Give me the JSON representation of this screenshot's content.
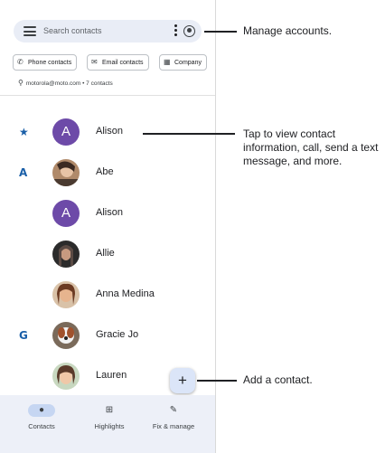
{
  "search": {
    "placeholder": "Search contacts"
  },
  "filters": [
    "Phone contacts",
    "Email contacts",
    "Company"
  ],
  "account_line": "motorola@moto.com • 7 contacts",
  "contacts": [
    {
      "index": "★",
      "initial": "A",
      "name": "Alison",
      "avatar": "letter"
    },
    {
      "index": "A",
      "initial": "",
      "name": "Abe",
      "avatar": "photo"
    },
    {
      "index": "",
      "initial": "A",
      "name": "Alison",
      "avatar": "letter"
    },
    {
      "index": "",
      "initial": "",
      "name": "Allie",
      "avatar": "photo"
    },
    {
      "index": "",
      "initial": "",
      "name": "Anna Medina",
      "avatar": "photo"
    },
    {
      "index": "G",
      "initial": "",
      "name": "Gracie Jo",
      "avatar": "photo"
    },
    {
      "index": "",
      "initial": "",
      "name": "Lauren",
      "avatar": "photo"
    }
  ],
  "fab_label": "+",
  "nav": [
    {
      "label": "Contacts",
      "icon": "person-icon",
      "active": true
    },
    {
      "label": "Highlights",
      "icon": "highlights-icon",
      "active": false
    },
    {
      "label": "Fix & manage",
      "icon": "wrench-icon",
      "active": false
    }
  ],
  "callouts": {
    "manage": "Manage accounts.",
    "tap": "Tap to view contact information, call, send a text message, and more.",
    "add": "Add a contact."
  },
  "colors": {
    "avatar_letter": "#6d4aa8",
    "index_letter": "#1a5fa8",
    "nav_bg": "#edf0f8",
    "search_bg": "#e9edf6"
  }
}
